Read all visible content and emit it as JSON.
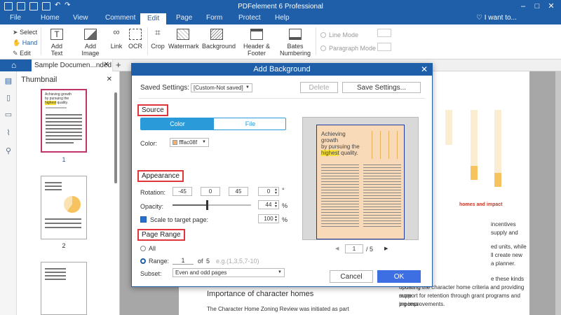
{
  "app": {
    "title": "PDFelement 6 Professional",
    "window_controls": [
      "–",
      "□",
      "✕"
    ]
  },
  "menu": {
    "items": [
      "File",
      "Home",
      "View",
      "Comment",
      "Edit",
      "Page",
      "Form",
      "Protect",
      "Help"
    ],
    "active": "Edit",
    "search_label": "I want to..."
  },
  "ribbon": {
    "select_label": "Select",
    "hand_label": "Hand",
    "edit_label": "Edit",
    "tools": [
      "Add Text",
      "Add Image",
      "Link",
      "OCR",
      "Crop",
      "Watermark",
      "Background",
      "Header & Footer",
      "Bates Numbering"
    ],
    "line_mode": "Line Mode",
    "paragraph_mode": "Paragraph Mode"
  },
  "tab": {
    "doc_name": "Sample Documen...nded"
  },
  "thumbnail": {
    "title": "Thumbnail",
    "pages": [
      "1",
      "2"
    ]
  },
  "thumb1": {
    "line1": "Achieving growth",
    "line2": "by pursuing the",
    "highlight": "highest",
    "line3": "quality."
  },
  "dialog": {
    "title": "Add Background",
    "saved_settings_label": "Saved Settings:",
    "saved_settings_value": "[Custom-Not saved]",
    "delete_label": "Delete",
    "save_settings_label": "Save Settings...",
    "source_heading": "Source",
    "color_tab": "Color",
    "file_tab": "File",
    "color_label": "Color:",
    "color_value": "fffac08f",
    "appearance_heading": "Appearance",
    "rotation_label": "Rotation:",
    "rotation_options": [
      "-45",
      "0",
      "45"
    ],
    "rotation_value": "0",
    "degree_unit": "°",
    "opacity_label": "Opacity:",
    "opacity_value": "44",
    "opacity_fraction": 0.44,
    "percent": "%",
    "scale_label": "Scale to target page:",
    "scale_value": "100",
    "page_range_heading": "Page Range",
    "all_label": "All",
    "range_label": "Range:",
    "range_from": "1",
    "range_of": "of",
    "range_total": "5",
    "range_example": "e.g.(1,3,5,7-10)",
    "subset_label": "Subset:",
    "subset_value": "Even and odd pages",
    "preview_page": "1",
    "preview_total": "/ 5",
    "cancel_label": "Cancel",
    "ok_label": "OK"
  },
  "preview": {
    "line1": "Achieving growth",
    "line2": "by pursuing the",
    "highlight": "highest",
    "line3": "quality.",
    "bg_color": "#f8d9b8"
  },
  "page_text": {
    "heading": "Importance of character homes",
    "body1": "The Character Home Zoning Review was initiated as part",
    "right_lines": [
      "incentives",
      "supply and",
      "ed units, while",
      "ll create new",
      "a planner.",
      "e these kinds",
      "updating the character home criteria and providing more",
      "support for retention through grant programs and process-",
      "ing improvements."
    ],
    "right_red": "homes and impact"
  },
  "colors": {
    "accent": "#1f5ea8",
    "highlight_red": "#e0353b",
    "chart_bar": "#f6c35f"
  }
}
